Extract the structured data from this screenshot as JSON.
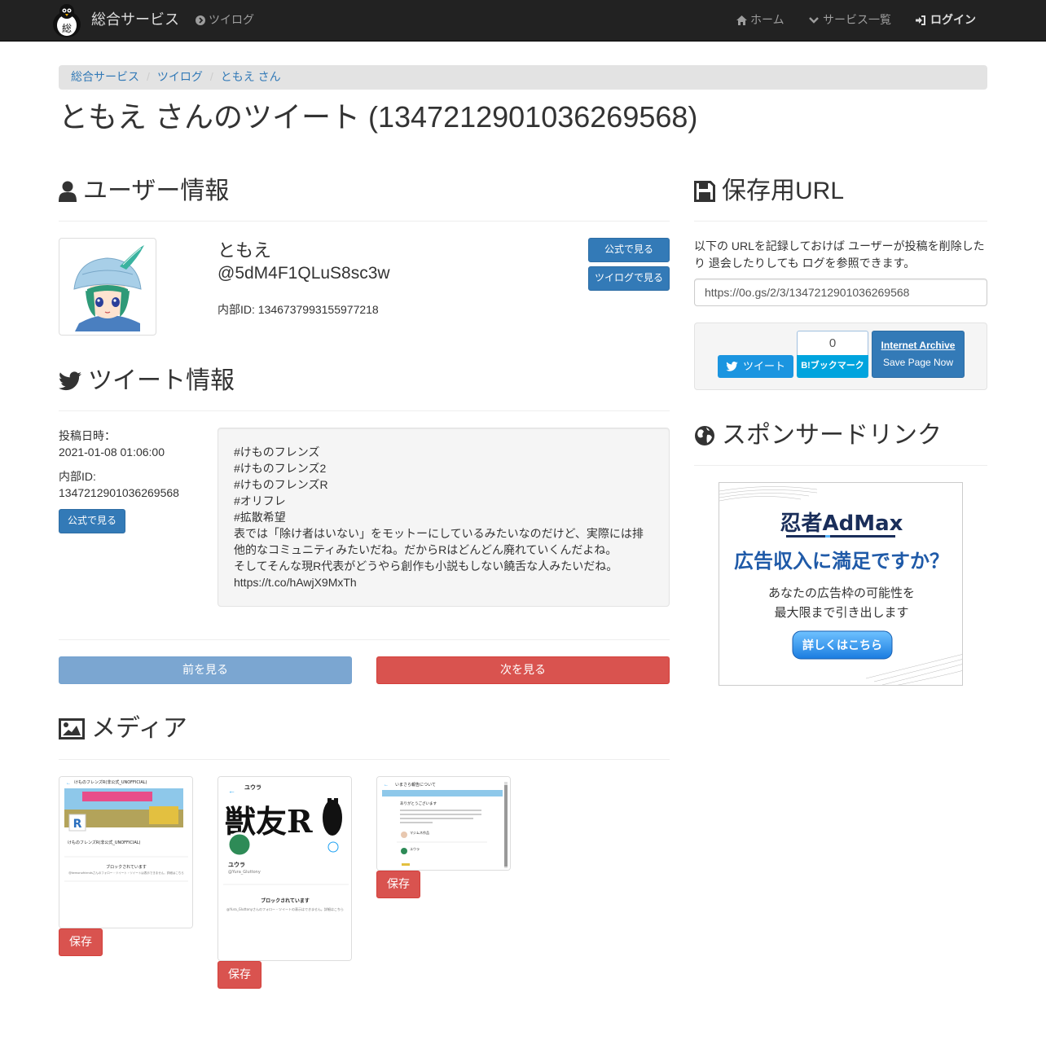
{
  "nav": {
    "brand": "総合サービス",
    "tweelog": "ツイログ",
    "home": "ホーム",
    "services": "サービス一覧",
    "login": "ログイン"
  },
  "breadcrumb": [
    "総合サービス",
    "ツイログ",
    "ともえ さん"
  ],
  "page_title": "ともえ さんのツイート (1347212901036269568)",
  "user_section": {
    "heading": "ユーザー情報",
    "name": "ともえ",
    "handle": "@5dM4F1QLuS8sc3w",
    "internal_id": "内部ID: 1346737993155977218",
    "btn_official": "公式で見る",
    "btn_tweelog": "ツイログで見る"
  },
  "tweet_section": {
    "heading": "ツイート情報",
    "posted_label": "投稿日時：",
    "posted_value": "2021-01-08 01:06:00",
    "id_label": "内部ID:",
    "id_value": "1347212901036269568",
    "btn_official": "公式で見る",
    "lines": [
      "#けものフレンズ",
      "#けものフレンズ2",
      "#けものフレンズR",
      "#オリフレ",
      "#拡散希望",
      "表では「除け者はいない」をモットーにしているみたいなのだけど、実際には排",
      "他的なコミュニティみたいだね。だからRはどんどん廃れていくんだよね。",
      "そしてそんな現R代表がどうやら創作も小説もしない饒舌な人みたいだね。",
      "https://t.co/hAwjX9MxTh"
    ],
    "prev": "前を見る",
    "next": "次を見る"
  },
  "media_section": {
    "heading": "メディア",
    "save_label": "保存",
    "thumb1": {
      "title": "けものフレンズR(非公式_UNOFFICIAL)",
      "sub": "けものフレンズR(非公式_UNOFFICIAL)",
      "blocked": "ブロックされています",
      "blocked_desc": "@kemonofriendsさんのフォロー・ツイート・ツイートは表示できません。詳細はこちら"
    },
    "thumb2": {
      "top": "ユウラ",
      "logo": "獣友R",
      "name": "ユウラ",
      "handle": "@Yura_Gluttony",
      "blocked": "ブロックされています",
      "blocked_desc": "@Yura_Gluttonyさんのフォロー・ツイートの表示はできません。詳細はこちら"
    },
    "thumb3": {
      "title": "いまさら報告について",
      "msg": "ありがとうございます",
      "u1": "マジムネ作品",
      "u2": "ユウラ"
    }
  },
  "save_url": {
    "heading": "保存用URL",
    "desc": "以下の URLを記録しておけば ユーザーが投稿を削除したり 退会したりしても ログを参照できます。",
    "url": "https://0o.gs/2/3/1347212901036269568",
    "tweet_btn": "ツイート",
    "hatena_count": "0",
    "hatena_btn": "B!ブックマーク",
    "ia_title": "Internet Archive",
    "ia_sub": "Save Page Now"
  },
  "sponsor": {
    "heading": "スポンサードリンク",
    "ad_brand": "忍者AdMax",
    "ad_headline": "広告収入に満足ですか？",
    "ad_line1": "あなたの広告枠の可能性を",
    "ad_line2": "最大限まで引き出します",
    "ad_button": "詳しくはこちら"
  },
  "colors": {
    "navbar": "#222222",
    "primary": "#337ab7",
    "danger": "#d9534f",
    "twitter": "#1b95e0",
    "hatena": "#00a4de"
  }
}
